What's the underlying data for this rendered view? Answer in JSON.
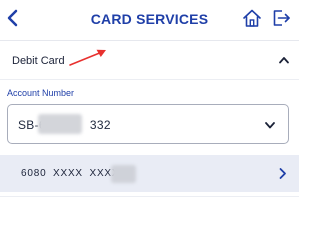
{
  "header": {
    "title": "CARD SERVICES",
    "back_icon": "chevron-left-icon",
    "home_icon": "home-icon",
    "logout_icon": "logout-icon"
  },
  "section": {
    "title": "Debit Card",
    "expanded": true
  },
  "account": {
    "label": "Account Number",
    "value_prefix": "SB-6",
    "value_suffix": "332"
  },
  "card": {
    "number_visible": "6080  XXXX  XXXX"
  },
  "colors": {
    "primary": "#1f3fa8",
    "annotation_red": "#e8312f",
    "row_bg": "#e9ecf5"
  }
}
